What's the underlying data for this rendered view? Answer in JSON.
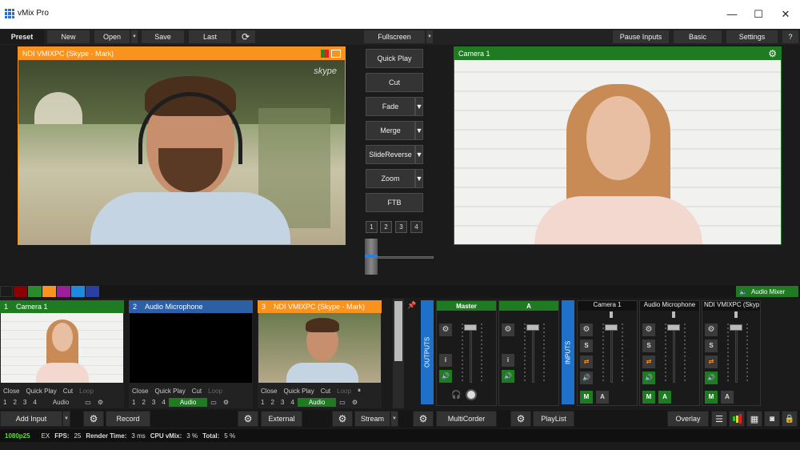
{
  "window": {
    "title": "vMix Pro",
    "minimize": "—",
    "maximize": "☐",
    "close": "✕"
  },
  "toolbar": {
    "preset": "Preset",
    "new": "New",
    "open": "Open",
    "save": "Save",
    "last": "Last",
    "fullscreen": "Fullscreen",
    "pause_inputs": "Pause Inputs",
    "basic": "Basic",
    "settings": "Settings",
    "help": "?"
  },
  "preview": {
    "title": "NDI VMIXPC (Skype - Mark)",
    "watermark": "skype"
  },
  "output": {
    "title": "Camera 1"
  },
  "transitions": {
    "quick_play": "Quick Play",
    "cut": "Cut",
    "fade": "Fade",
    "merge": "Merge",
    "slide_reverse": "SlideReverse",
    "zoom": "Zoom",
    "ftb": "FTB",
    "numbers": [
      "1",
      "2",
      "3",
      "4"
    ]
  },
  "colors": {
    "swatches": [
      "#1b1b1b",
      "#8b0000",
      "#2a8b2a",
      "#f7931e",
      "#9b1f9b",
      "#1f8be0",
      "#2a3fa5"
    ],
    "accent_green": "#1e7b22",
    "accent_orange": "#f7931e",
    "accent_blue": "#2d5fa5"
  },
  "audio_mixer_label": "Audio Mixer",
  "inputs": [
    {
      "num": "1",
      "name": "Camera 1",
      "close": "Close",
      "quick_play": "Quick Play",
      "cut": "Cut",
      "loop": "Loop",
      "nums": [
        "1",
        "2",
        "3",
        "4"
      ],
      "audio": "Audio"
    },
    {
      "num": "2",
      "name": "Audio Microphone",
      "close": "Close",
      "quick_play": "Quick Play",
      "cut": "Cut",
      "loop": "Loop",
      "nums": [
        "1",
        "2",
        "3",
        "4"
      ],
      "audio": "Audio"
    },
    {
      "num": "3",
      "name": "NDI VMIXPC (Skype - Mark)",
      "close": "Close",
      "quick_play": "Quick Play",
      "cut": "Cut",
      "loop": "Loop",
      "nums": [
        "1",
        "2",
        "3",
        "4"
      ],
      "audio": "Audio"
    }
  ],
  "mixer": {
    "outputs_label": "OUTPUTS",
    "inputs_label": "INPUTS",
    "master": "Master",
    "bus_a": "A",
    "channels": [
      "Camera 1",
      "Audio Microphone",
      "NDI VMIXPC (Skyp"
    ],
    "s": "S",
    "m": "M",
    "a": "A",
    "i": "i"
  },
  "bottombar": {
    "add_input": "Add Input",
    "record": "Record",
    "external": "External",
    "stream": "Stream",
    "multicorder": "MultiCorder",
    "playlist": "PlayList",
    "overlay": "Overlay"
  },
  "status": {
    "format": "1080p25",
    "ex": "EX",
    "fps_label": "FPS:",
    "fps": "25",
    "render_label": "Render Time:",
    "render": "3 ms",
    "cpu_label": "CPU vMix:",
    "cpu": "3 %",
    "total_label": "Total:",
    "total": "5 %"
  }
}
